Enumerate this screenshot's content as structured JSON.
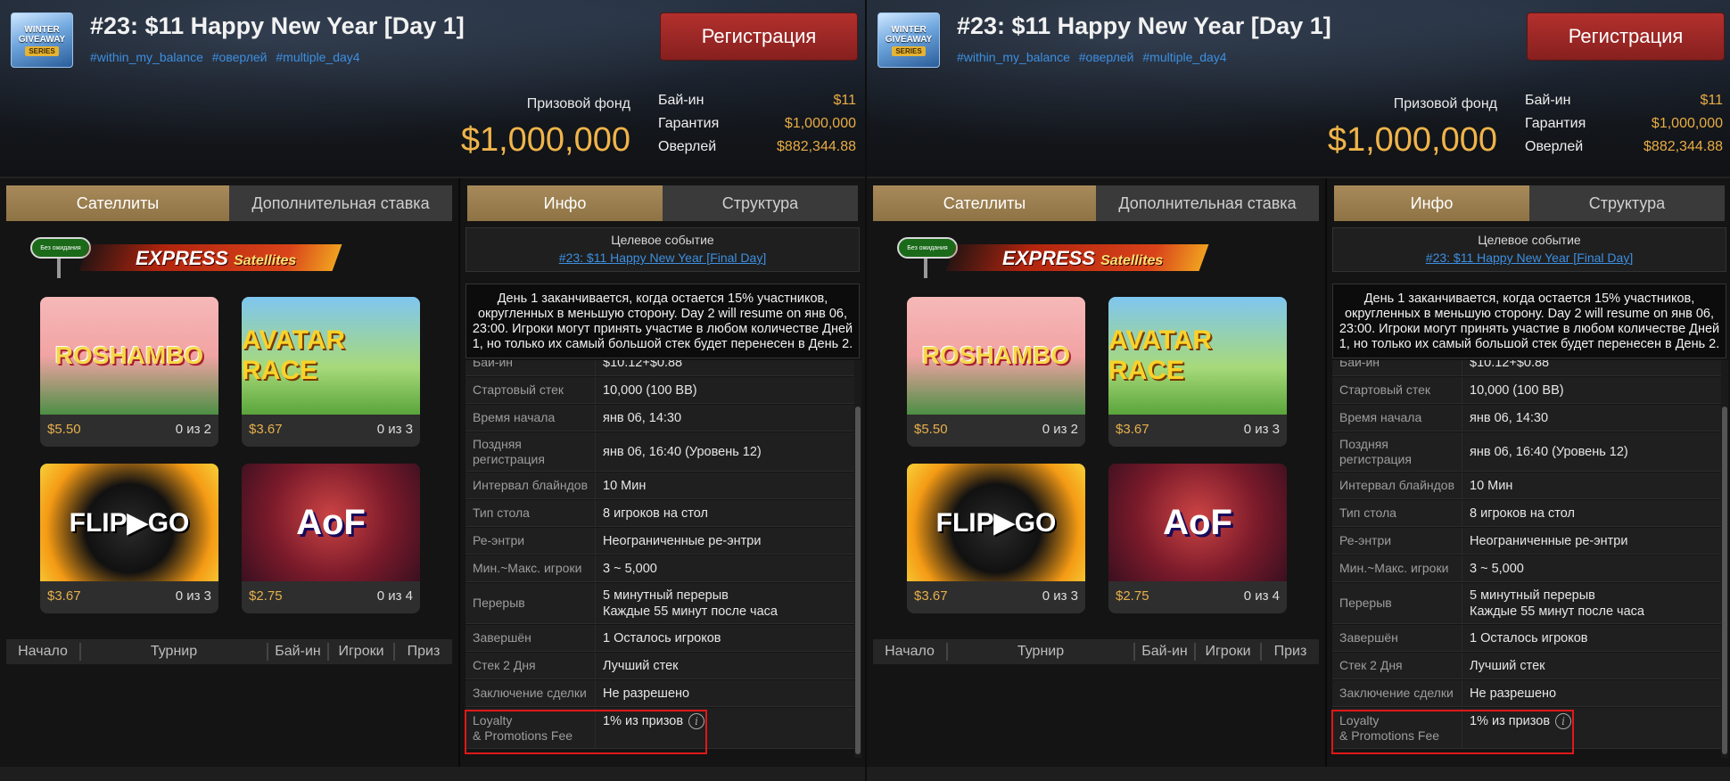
{
  "header": {
    "logo_text": [
      "WINTER",
      "GIVEAWAY",
      "SERIES"
    ],
    "title": "#23: $11 Happy New Year [Day 1]",
    "tags": [
      "#within_my_balance",
      "#оверлей",
      "#multiple_day4"
    ],
    "register_button": "Регистрация",
    "prize_pool_label": "Призовой фонд",
    "prize_pool_value": "$1,000,000",
    "stats": [
      {
        "label": "Бай-ин",
        "value": "$11"
      },
      {
        "label": "Гарантия",
        "value": "$1,000,000"
      },
      {
        "label": "Оверлей",
        "value": "$882,344.88"
      }
    ]
  },
  "left_tabs": [
    "Сателлиты",
    "Дополнительная ставка"
  ],
  "right_tabs": [
    "Инфо",
    "Структура"
  ],
  "express_banner": {
    "sign_text": "Без ожидания",
    "title": "EXPRESS",
    "subtitle": "Satellites"
  },
  "satellites": [
    {
      "game": "ROSHAMBO",
      "price": "$5.50",
      "count": "0 из 2"
    },
    {
      "game": "AVATAR RACE",
      "price": "$3.67",
      "count": "0 из 3"
    },
    {
      "game": "FLIP▶GO",
      "price": "$3.67",
      "count": "0 из 3"
    },
    {
      "game": "AoF",
      "price": "$2.75",
      "count": "0 из 4"
    }
  ],
  "table_headers": [
    "Начало",
    "Турнир",
    "Бай-ин",
    "Игроки",
    "Приз"
  ],
  "target_event": {
    "label": "Целевое событие",
    "link": "#23: $11 Happy New Year [Final Day]"
  },
  "day_note": "День 1 заканчивается, когда остается 15% участников, округленных в меньшую сторону. Day 2 will resume on янв 06, 23:00. Игроки могут принять участие в любом количестве Дней 1, но только их самый большой стек будет перенесен в День 2.",
  "info_rows": [
    {
      "label": "Бай-ин",
      "value": "$10.12+$0.88"
    },
    {
      "label": "Стартовый стек",
      "value": "10,000 (100 BB)"
    },
    {
      "label": "Время начала",
      "value": "янв 06, 14:30"
    },
    {
      "label": "Поздняя регистрация",
      "value": "янв 06, 16:40 (Уровень 12)"
    },
    {
      "label": "Интервал блайндов",
      "value": "10 Мин"
    },
    {
      "label": "Тип стола",
      "value": "8 игроков на стол"
    },
    {
      "label": "Ре-энтри",
      "value": "Неограниченные ре-энтри"
    },
    {
      "label": "Мин.~Макс. игроки",
      "value": "3 ~ 5,000"
    },
    {
      "label": "Перерыв",
      "value": "5 минутный перерыв",
      "value2": "Каждые 55 минут после часа"
    },
    {
      "label": "Завершён",
      "value": "1 Осталось игроков"
    },
    {
      "label": "Стек 2 Дня",
      "value": "Лучший стек"
    },
    {
      "label": "Заключение сделки",
      "value": "Не разрешено"
    },
    {
      "label": "Loyalty",
      "label2": "& Promotions Fee",
      "value": "1% из призов"
    }
  ]
}
